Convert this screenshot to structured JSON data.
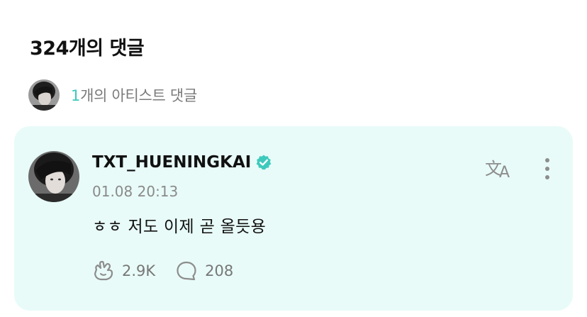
{
  "header": {
    "comments_title": "324개의 댓글"
  },
  "artist_summary": {
    "count": "1",
    "label": "개의 아티스트 댓글",
    "accent_color": "#3cc8bb"
  },
  "comment": {
    "username": "TXT_HUENINGKAI",
    "verified": true,
    "timestamp": "01.08 20:13",
    "body": "ㅎㅎ 저도 이제 곧 올듯용",
    "likes": "2.9K",
    "replies": "208",
    "card_color": "#e8fbf8",
    "verified_color": "#3ec9bd"
  },
  "icons": {
    "translate": "translate-icon",
    "more": "more-vertical-icon",
    "like": "cheer-hand-icon",
    "reply": "speech-bubble-icon",
    "verified": "verified-badge-icon"
  }
}
